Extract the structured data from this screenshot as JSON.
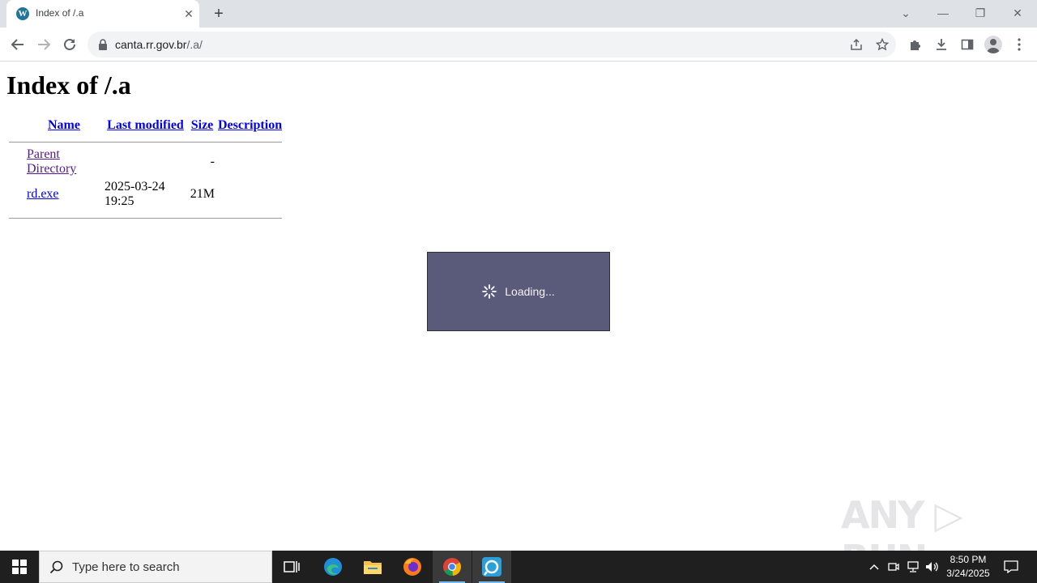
{
  "browser": {
    "tab_title": "Index of /.a",
    "url_host": "canta.rr.gov.br",
    "url_path": "/.a/"
  },
  "page": {
    "heading": "Index of /.a",
    "columns": {
      "name": "Name",
      "last_modified": "Last modified",
      "size": "Size",
      "description": "Description"
    },
    "rows": [
      {
        "name": "Parent Directory",
        "last_modified": "",
        "size": "-",
        "description": ""
      },
      {
        "name": "rd.exe",
        "last_modified": "2025-03-24 19:25",
        "size": "21M",
        "description": ""
      }
    ]
  },
  "overlay": {
    "loading_text": "Loading..."
  },
  "watermark": "ANY RUN",
  "taskbar": {
    "search_placeholder": "Type here to search",
    "time": "8:50 PM",
    "date": "3/24/2025",
    "apps": [
      "task-view-icon",
      "edge-icon",
      "file-explorer-icon",
      "firefox-icon",
      "chrome-icon",
      "anyrun-icon"
    ]
  }
}
